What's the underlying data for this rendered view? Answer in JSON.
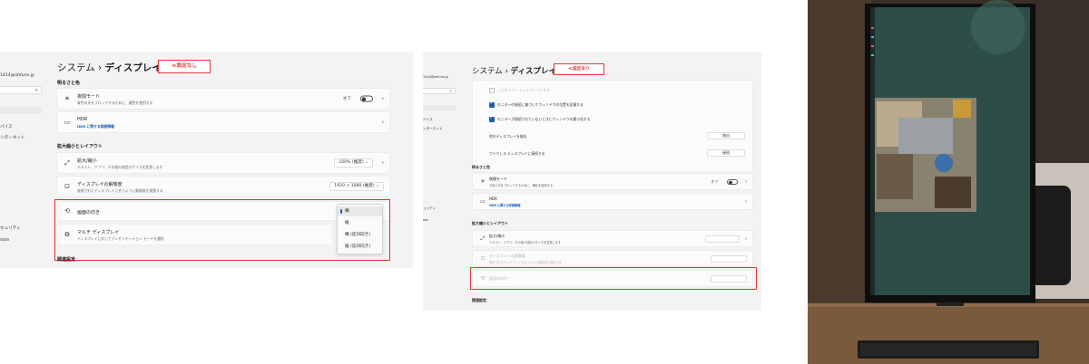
{
  "panel1": {
    "sidebar": {
      "email": "1414@ohfune.jp",
      "items": [
        "バイス",
        "ンターネット",
        "キュリティ",
        "date"
      ]
    },
    "title_prefix": "システム",
    "title_sep": "›",
    "title_main": "ディスプレイ",
    "tag": "≪設定なし",
    "section_brightness": "明るさと色",
    "night_light": {
      "title": "夜間モード",
      "desc": "青色の光をブロックするために、暖色を使用する",
      "state": "オフ"
    },
    "hdr": {
      "title": "HDR",
      "link": "HDR に関する詳細情報"
    },
    "section_scale": "拡大縮小とレイアウト",
    "scale": {
      "title": "拡大/縮小",
      "desc": "テキスト、アプリ、その他の項目のサイズを変更します",
      "value": "100% (推奨)"
    },
    "resolution": {
      "title": "ディスプレイの解像度",
      "desc": "接続されたディスプレイに合うように解像度を調整する",
      "value": "1920 × 1080 (推奨)"
    },
    "orientation": {
      "title": "画面の向き"
    },
    "multi": {
      "title": "マルチ ディスプレイ",
      "desc": "ディスプレイに対してプレゼンテーション モードを選択"
    },
    "orientation_menu": [
      "横",
      "縦",
      "横 (反対向き)",
      "縦 (反対向き)"
    ],
    "section_related": "関連設定"
  },
  "panel2": {
    "sidebar": {
      "email": "1414@ohfune.jp",
      "items": [
        "バイス",
        "ンターネット",
        "ュリティ",
        "ate"
      ]
    },
    "title_prefix": "システム",
    "title_sep": "›",
    "title_main": "ディスプレイ",
    "tag": "≪設定あり",
    "rows": [
      "これをメイン ディスプレイにする",
      "モニターの接続に基づいてウィンドウの位置を記憶する",
      "モニターが接続されていないときにウィンドウを最小化する"
    ],
    "detect": {
      "label": "他のディスプレイを検出",
      "button": "検出"
    },
    "wireless": {
      "label": "ワイヤレス ディスプレイに接続する",
      "button": "接続"
    },
    "section_brightness": "明るさと色",
    "night_light": {
      "title": "夜間モード",
      "desc": "青色の光をブロックするために、暖色を使用する",
      "state": "オフ"
    },
    "hdr": {
      "title": "HDR",
      "link": "HDR に関する詳細情報"
    },
    "section_scale": "拡大縮小とレイアウト",
    "scale": {
      "title": "拡大/縮小",
      "desc": "テキスト、アプリ、その他の項目のサイズを変更します"
    },
    "resolution": {
      "title": "ディスプレイの解像度",
      "desc": "接続されたディスプレイに合うように解像度を調整する"
    },
    "orientation": {
      "title": "画面の向き"
    },
    "section_related": "関連設定"
  },
  "photo": {
    "description_icon": "monitor-portrait-photo"
  },
  "colors": {
    "accent": "#1d5fb8",
    "highlight_red": "#d33333",
    "screen_teal": "#2d4e48"
  }
}
